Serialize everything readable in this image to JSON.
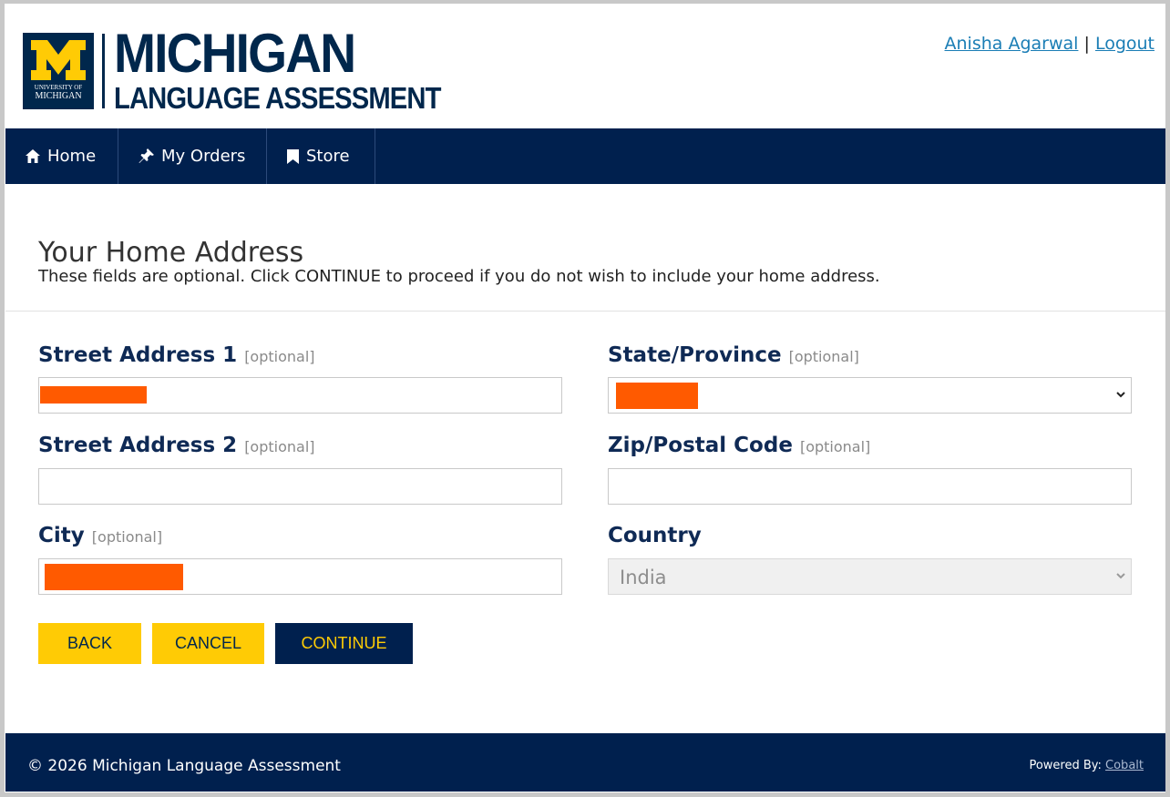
{
  "header": {
    "logo": {
      "title": "MICHIGAN",
      "subtitle": "LANGUAGE ASSESSMENT",
      "seal_small": "UNIVERSITY OF",
      "seal_big": "MICHIGAN"
    },
    "user_name": "Anisha Agarwal",
    "separator": "|",
    "logout": "Logout"
  },
  "nav": {
    "items": [
      {
        "label": "Home",
        "icon": "home-icon"
      },
      {
        "label": "My Orders",
        "icon": "pin-icon"
      },
      {
        "label": "Store",
        "icon": "bookmark-icon"
      }
    ]
  },
  "page": {
    "title": "Your Home Address",
    "description": "These fields are optional. Click CONTINUE to proceed if you do not wish to include your home address."
  },
  "form": {
    "optional_tag": "[optional]",
    "street1": {
      "label": "Street Address 1",
      "value": "[redacted]"
    },
    "street2": {
      "label": "Street Address 2",
      "value": ""
    },
    "city": {
      "label": "City",
      "value": "[redacted]"
    },
    "state": {
      "label": "State/Province",
      "value": "[redacted]"
    },
    "zip": {
      "label": "Zip/Postal Code",
      "value": ""
    },
    "country": {
      "label": "Country",
      "value": "India"
    }
  },
  "buttons": {
    "back": "BACK",
    "cancel": "CANCEL",
    "continue": "CONTINUE"
  },
  "footer": {
    "copyright": "© 2026 Michigan Language Assessment",
    "powered_by": "Powered By:",
    "vendor": "Cobalt"
  },
  "colors": {
    "navy": "#00274c",
    "maize": "#ffcb05",
    "redaction": "#ff5a00",
    "link": "#1a7db5"
  }
}
